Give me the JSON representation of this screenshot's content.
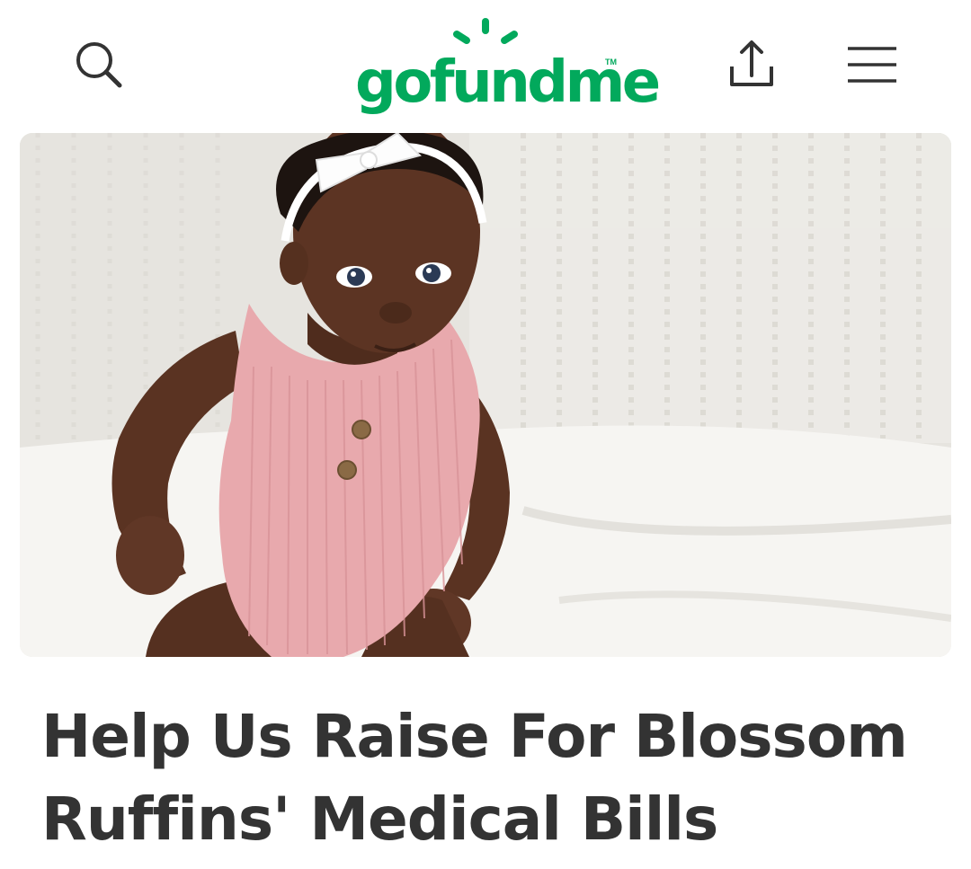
{
  "header": {
    "search_icon": "search-icon",
    "logo_text": "gofundme",
    "logo_tm": "TM",
    "share_icon": "share-upload-icon",
    "menu_icon": "hamburger-menu-icon"
  },
  "colors": {
    "brand_green": "#02a95c",
    "title_text": "#333333",
    "icon_stroke": "#333333"
  },
  "campaign": {
    "hero_image": "baby-photo",
    "title": "Help Us Raise For Blossom Ruffins' Medical Bills"
  }
}
